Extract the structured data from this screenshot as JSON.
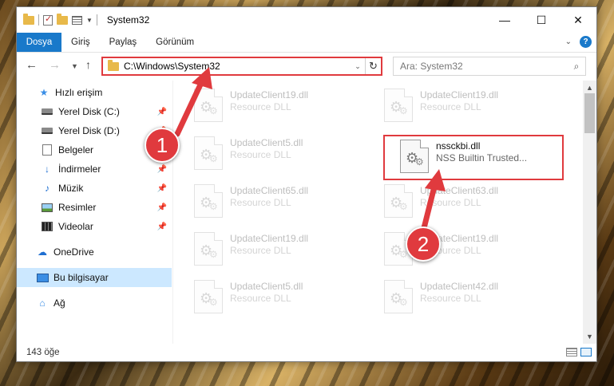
{
  "window": {
    "title": "System32",
    "controls": {
      "minimize": "—",
      "maximize": "☐",
      "close": "✕"
    }
  },
  "ribbon": {
    "tabs": [
      "Dosya",
      "Giriş",
      "Paylaş",
      "Görünüm"
    ]
  },
  "navigation": {
    "address": "C:\\Windows\\System32",
    "search_placeholder": "Ara: System32"
  },
  "sidebar": {
    "items": [
      {
        "label": "Hızlı erişim",
        "icon": "star-icon"
      },
      {
        "label": "Yerel Disk (C:)",
        "icon": "disk-icon",
        "pinned": true
      },
      {
        "label": "Yerel Disk (D:)",
        "icon": "disk-icon",
        "pinned": true
      },
      {
        "label": "Belgeler",
        "icon": "documents-icon",
        "pinned": true
      },
      {
        "label": "İndirmeler",
        "icon": "download-icon",
        "pinned": true
      },
      {
        "label": "Müzik",
        "icon": "music-icon",
        "pinned": true
      },
      {
        "label": "Resimler",
        "icon": "pictures-icon",
        "pinned": true
      },
      {
        "label": "Videolar",
        "icon": "videos-icon",
        "pinned": true
      },
      {
        "label": "OneDrive",
        "icon": "cloud-icon"
      },
      {
        "label": "Bu bilgisayar",
        "icon": "computer-icon",
        "selected": true
      },
      {
        "label": "Ağ",
        "icon": "network-icon"
      }
    ]
  },
  "files": [
    {
      "name": "UpdateClient19.dll",
      "type": "Resource DLL",
      "faded": true
    },
    {
      "name": "UpdateClient19.dll",
      "type": "Resource DLL",
      "faded": true
    },
    {
      "name": "UpdateClient5.dll",
      "type": "Resource DLL",
      "faded": true
    },
    {
      "name": "nssckbi.dll",
      "type": "NSS Builtin Trusted...",
      "faded": false
    },
    {
      "name": "UpdateClient65.dll",
      "type": "Resource DLL",
      "faded": true
    },
    {
      "name": "UpdateClient63.dll",
      "type": "Resource DLL",
      "faded": true
    },
    {
      "name": "UpdateClient19.dll",
      "type": "Resource DLL",
      "faded": true
    },
    {
      "name": "UpdateClient19.dll",
      "type": "Resource DLL",
      "faded": true
    },
    {
      "name": "UpdateClient5.dll",
      "type": "Resource DLL",
      "faded": true
    },
    {
      "name": "UpdateClient42.dll",
      "type": "Resource DLL",
      "faded": true
    }
  ],
  "status": {
    "item_count": "143 öğe"
  },
  "annotations": {
    "step1": "1",
    "step2": "2"
  },
  "colors": {
    "accent": "#1979ca",
    "annotation_red": "#e03a3e",
    "selection": "#cce8ff"
  }
}
